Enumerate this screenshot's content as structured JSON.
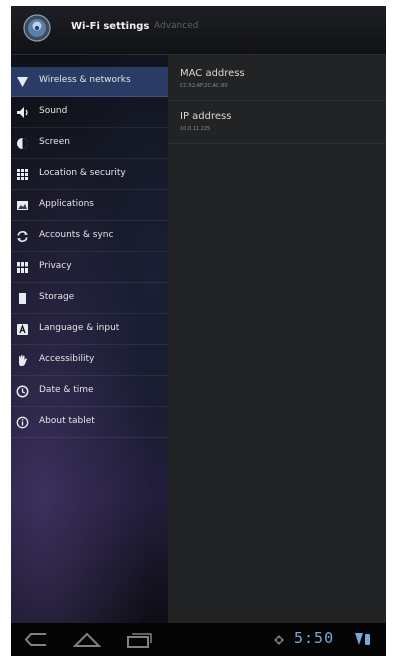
{
  "action_bar": {
    "title": "Wi-Fi settings",
    "tab": "Advanced",
    "icon": "settings-app-icon"
  },
  "sidebar": {
    "items": [
      {
        "label": "Wireless & networks",
        "icon": "wifi-icon",
        "selected": true
      },
      {
        "label": "Sound",
        "icon": "speaker-icon",
        "selected": false
      },
      {
        "label": "Screen",
        "icon": "brightness-icon",
        "selected": false
      },
      {
        "label": "Location & security",
        "icon": "grid-icon",
        "selected": false
      },
      {
        "label": "Applications",
        "icon": "applications-icon",
        "selected": false
      },
      {
        "label": "Accounts & sync",
        "icon": "sync-icon",
        "selected": false
      },
      {
        "label": "Privacy",
        "icon": "privacy-icon",
        "selected": false
      },
      {
        "label": "Storage",
        "icon": "storage-icon",
        "selected": false
      },
      {
        "label": "Language & input",
        "icon": "language-icon",
        "selected": false
      },
      {
        "label": "Accessibility",
        "icon": "hand-icon",
        "selected": false
      },
      {
        "label": "Date & time",
        "icon": "clock-icon",
        "selected": false
      },
      {
        "label": "About tablet",
        "icon": "info-icon",
        "selected": false
      }
    ]
  },
  "details": {
    "mac": {
      "label": "MAC address",
      "value": "CC:52:AF:2C:AC:80"
    },
    "ip": {
      "label": "IP address",
      "value": "10.0.11.225"
    }
  },
  "system_bar": {
    "time": "5:50",
    "buttons": [
      "back-icon",
      "home-icon",
      "recent-apps-icon"
    ]
  },
  "colors": {
    "selected_bg": "#2a3c66",
    "accent": "#7aa7d9",
    "detail_bg": "#222324"
  }
}
